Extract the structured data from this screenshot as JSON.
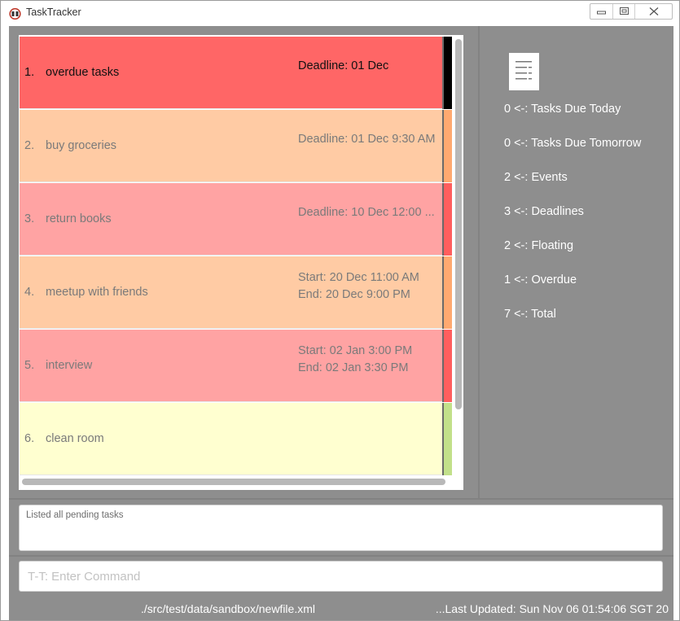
{
  "window": {
    "title": "TaskTracker",
    "controls": {
      "minimize": "minimize",
      "maximize": "maximize",
      "close": "close"
    }
  },
  "tasks": [
    {
      "index": "1.",
      "name": "overdue tasks",
      "line1": "Deadline: 01 Dec",
      "line2": "",
      "bg": "#ff6666",
      "stripe": "#000000",
      "text_color": "#111111"
    },
    {
      "index": "2.",
      "name": "buy groceries",
      "line1": "Deadline: 01 Dec 9:30 AM",
      "line2": "",
      "bg": "#ffcba4",
      "stripe": "#ffa970",
      "text_color": "#7a7a7a"
    },
    {
      "index": "3.",
      "name": "return books",
      "line1": "Deadline: 10 Dec 12:00 ...",
      "line2": "",
      "bg": "#ffa3a3",
      "stripe": "#ff5e5e",
      "text_color": "#7a7a7a"
    },
    {
      "index": "4.",
      "name": "meetup with friends",
      "line1": "Start: 20 Dec 11:00 AM",
      "line2": "End: 20 Dec 9:00 PM",
      "bg": "#ffcba4",
      "stripe": "#ffa970",
      "text_color": "#7a7a7a"
    },
    {
      "index": "5.",
      "name": "interview",
      "line1": "Start: 02 Jan 3:00 PM",
      "line2": "End: 02 Jan 3:30 PM",
      "bg": "#ffa3a3",
      "stripe": "#ff5e5e",
      "text_color": "#7a7a7a"
    },
    {
      "index": "6.",
      "name": "clean room",
      "line1": "",
      "line2": "",
      "bg": "#ffffd0",
      "stripe": "#c2e08a",
      "text_color": "#7a7a7a"
    }
  ],
  "summary": {
    "icon": "list-icon",
    "items": [
      "0 <-: Tasks Due Today",
      "0 <-: Tasks Due Tomorrow",
      "2 <-: Events",
      "3 <-: Deadlines",
      "2 <-: Floating",
      "1 <-: Overdue",
      "7 <-: Total"
    ]
  },
  "result": {
    "text": "Listed all pending tasks"
  },
  "command": {
    "value": "",
    "placeholder": "T-T: Enter Command"
  },
  "status": {
    "file": "./src/test/data/sandbox/newfile.xml",
    "updated": "...Last Updated: Sun Nov 06 01:54:06 SGT 20"
  }
}
